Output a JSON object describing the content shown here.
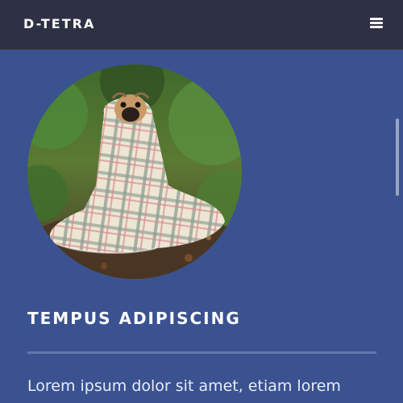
{
  "header": {
    "brand": "D-TETRA",
    "menu_icon": "hamburger-menu-icon"
  },
  "main": {
    "image_alt": "Pug wrapped in a plaid blanket",
    "title": "TEMPUS ADIPISCING",
    "body": "Lorem ipsum dolor sit amet, etiam lorem"
  },
  "colors": {
    "header_bg": "#2e3143",
    "page_bg": "#3a5290",
    "divider": "#5f76ad",
    "text": "#ffffff"
  }
}
